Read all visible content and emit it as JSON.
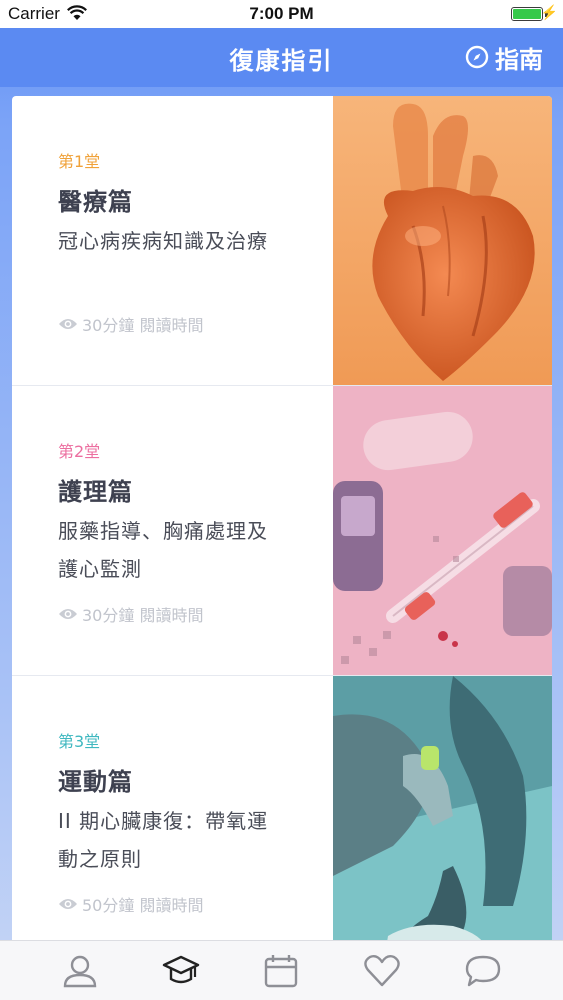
{
  "status_bar": {
    "carrier": "Carrier",
    "time": "7:00 PM"
  },
  "nav": {
    "title": "復康指引",
    "guide_label": "指南",
    "guide_icon": "compass-icon"
  },
  "lessons": [
    {
      "lesson_label": "第1堂",
      "category": "醫療篇",
      "description": "冠心病疾病知識及治療",
      "read_time": "30分鐘 閱讀時間",
      "accent": "#f0a23a",
      "image": "heart-illustration"
    },
    {
      "lesson_label": "第2堂",
      "category": "護理篇",
      "description": "服藥指導、胸痛處理及護心監測",
      "read_time": "30分鐘 閱讀時間",
      "accent": "#ec6fa0",
      "image": "medical-supplies-photo"
    },
    {
      "lesson_label": "第3堂",
      "category": "運動篇",
      "description": "II 期心臟康復：帶氧運動之原則",
      "read_time": "50分鐘 閱讀時間",
      "accent": "#3fb8c0",
      "image": "runner-photo"
    }
  ],
  "tabs": [
    {
      "icon": "profile-icon",
      "selected": false
    },
    {
      "icon": "graduation-cap-icon",
      "selected": true
    },
    {
      "icon": "calendar-icon",
      "selected": false
    },
    {
      "icon": "heart-icon",
      "selected": false
    },
    {
      "icon": "chat-bubble-icon",
      "selected": false
    }
  ],
  "colors": {
    "nav_bg": "#5b8af2",
    "tab_selected": "#222222",
    "tab_unselected": "#8e8f96"
  }
}
